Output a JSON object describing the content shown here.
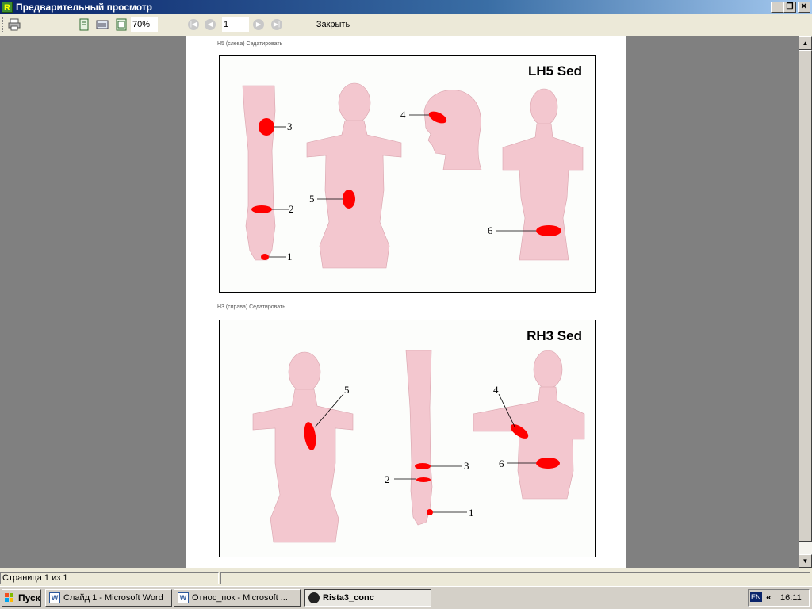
{
  "window": {
    "title": "Предварительный просмотр",
    "app_icon_letter": "R"
  },
  "toolbar": {
    "zoom_value": "70%",
    "page_value": "1",
    "close_label": "Закрыть"
  },
  "document": {
    "sections": [
      {
        "caption": "Н5 (слева) Седатировать",
        "title": "LH5 Sed",
        "labels": [
          "1",
          "2",
          "3",
          "4",
          "5",
          "6"
        ]
      },
      {
        "caption": "Н3 (справа) Седатировать",
        "title": "RH3 Sed",
        "labels": [
          "1",
          "2",
          "3",
          "4",
          "5",
          "6"
        ]
      }
    ]
  },
  "statusbar": {
    "page_info": "Страница 1 из 1"
  },
  "taskbar": {
    "start_label": "Пуск",
    "tasks": [
      {
        "label": "Слайд 1 - Microsoft Word",
        "icon": "word-icon",
        "active": false
      },
      {
        "label": "Относ_пок - Microsoft ...",
        "icon": "word-icon",
        "active": false
      },
      {
        "label": "Rista3_conc",
        "icon": "rista-icon",
        "active": true
      }
    ],
    "language": "EN",
    "tray_toggle": "«",
    "clock": "16:11"
  },
  "colors": {
    "titlebar": "#0a246a",
    "acupoint": "#ff0000",
    "skin": "#f3c7cf",
    "viewport": "#808080"
  }
}
